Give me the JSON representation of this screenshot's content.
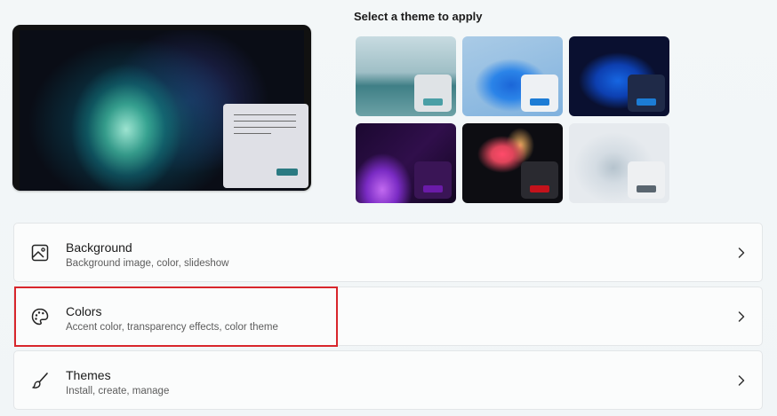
{
  "themes_section": {
    "title": "Select a theme to apply",
    "themes": [
      {
        "name": "theme-glow",
        "accent": "#4a9fa6"
      },
      {
        "name": "theme-bloom-light",
        "accent": "#1c7cd5"
      },
      {
        "name": "theme-bloom-dark",
        "accent": "#1c7cd5"
      },
      {
        "name": "theme-captured-motion",
        "accent": "#6a1ba8"
      },
      {
        "name": "theme-sunrise",
        "accent": "#c4121b"
      },
      {
        "name": "theme-flow",
        "accent": "#5a6670"
      }
    ]
  },
  "settings": [
    {
      "title": "Background",
      "subtitle": "Background image, color, slideshow",
      "icon": "image-icon"
    },
    {
      "title": "Colors",
      "subtitle": "Accent color, transparency effects, color theme",
      "icon": "palette-icon",
      "highlighted": true
    },
    {
      "title": "Themes",
      "subtitle": "Install, create, manage",
      "icon": "brush-icon"
    }
  ],
  "colors": {
    "highlight_border": "#d8262c",
    "preview_accent": "#2b7a82"
  }
}
